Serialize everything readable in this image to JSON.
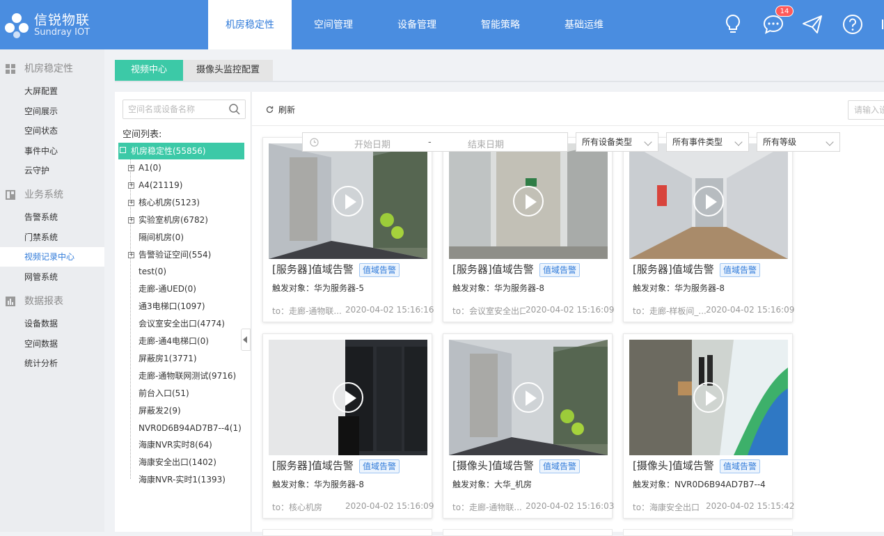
{
  "header": {
    "logo_cn": "信锐物联",
    "logo_en": "Sundray IOT",
    "tabs": [
      "机房稳定性",
      "空间管理",
      "设备管理",
      "智能策略",
      "基础运维"
    ],
    "active_tab": "机房稳定性",
    "message_badge": "14",
    "icons": [
      "lightbulb-icon",
      "message-icon",
      "send-icon",
      "help-icon"
    ]
  },
  "sidebar": {
    "groups": [
      {
        "label": "机房稳定性",
        "icon": "dashboard-icon",
        "items": [
          "大屏配置",
          "空间展示",
          "空间状态",
          "事件中心",
          "云守护"
        ]
      },
      {
        "label": "业务系统",
        "icon": "grid-icon",
        "items": [
          "告警系统",
          "门禁系统",
          "视频记录中心",
          "网管系统"
        ]
      },
      {
        "label": "数据报表",
        "icon": "chart-icon",
        "items": [
          "设备数据",
          "空间数据",
          "统计分析"
        ]
      }
    ],
    "active_item": "视频记录中心"
  },
  "subtabs": [
    "视频中心",
    "摄像头监控配置"
  ],
  "tree": {
    "search_placeholder": "空间名或设备名称",
    "title": "空间列表:",
    "root": "机房稳定性(55856)",
    "nodes": [
      {
        "label": "A1(0)",
        "expandable": true
      },
      {
        "label": "A4(21119)",
        "expandable": true
      },
      {
        "label": "核心机房(5123)",
        "expandable": true
      },
      {
        "label": "实验室机房(6782)",
        "expandable": true
      },
      {
        "label": "隔间机房(0)",
        "expandable": false
      },
      {
        "label": "告警验证空间(554)",
        "expandable": true
      },
      {
        "label": "test(0)",
        "expandable": false
      },
      {
        "label": "走廊-通UED(0)",
        "expandable": false
      },
      {
        "label": "通3电梯口(1097)",
        "expandable": false
      },
      {
        "label": "会议室安全出口(4774)",
        "expandable": false
      },
      {
        "label": "走廊-通4电梯口(0)",
        "expandable": false
      },
      {
        "label": "屏蔽房1(3771)",
        "expandable": false
      },
      {
        "label": "走廊-通物联网测试(9716)",
        "expandable": false
      },
      {
        "label": "前台入口(51)",
        "expandable": false
      },
      {
        "label": "屏蔽发2(9)",
        "expandable": false
      },
      {
        "label": "NVR0D6B94AD7B7--4(1)",
        "expandable": false
      },
      {
        "label": "海康NVR实时8(64)",
        "expandable": false
      },
      {
        "label": "海康安全出口(1402)",
        "expandable": false
      },
      {
        "label": "海康NVR-实时1(1393)",
        "expandable": false
      }
    ]
  },
  "toolbar": {
    "refresh": "刷新",
    "right_input_placeholder": "请输入设",
    "start_date": "开始日期",
    "date_sep": "-",
    "end_date": "结束日期",
    "device_type": "所有设备类型",
    "event_type": "所有事件类型",
    "level": "所有等级"
  },
  "cards": [
    {
      "title": "[服务器]值域告警",
      "tag": "值域告警",
      "target": "触发对象：华为服务器-5",
      "location": "to：走廊-通物联...",
      "time": "2020-04-02 15:16:16",
      "scene": "corridor"
    },
    {
      "title": "[服务器]值域告警",
      "tag": "值域告警",
      "target": "触发对象：华为服务器-8",
      "location": "to：会议室安全出口",
      "time": "2020-04-02 15:16:09",
      "scene": "door"
    },
    {
      "title": "[服务器]值域告警",
      "tag": "值域告警",
      "target": "触发对象：华为服务器-8",
      "location": "to：走廊-样板间_...",
      "time": "2020-04-02 15:16:09",
      "scene": "hallway"
    },
    {
      "title": "[服务器]值域告警",
      "tag": "值域告警",
      "target": "触发对象：华为服务器-8",
      "location": "to：核心机房",
      "time": "2020-04-02 15:16:09",
      "scene": "serverroom"
    },
    {
      "title": "[摄像头]值域告警",
      "tag": "值域告警",
      "target": "触发对象：大华_机房",
      "location": "to：走廊-通物联...",
      "time": "2020-04-02 15:16:03",
      "scene": "corridor"
    },
    {
      "title": "[摄像头]值域告警",
      "tag": "值域告警",
      "target": "触发对象：NVR0D6B94AD7B7--4",
      "location": "to：海康安全出口",
      "time": "2020-04-02 15:15:42",
      "scene": "lobby"
    }
  ],
  "colors": {
    "primary": "#4a8de0",
    "accent": "#3cc9a7",
    "tag_blue": "#2f7ad9",
    "badge": "#ff5a5a"
  }
}
